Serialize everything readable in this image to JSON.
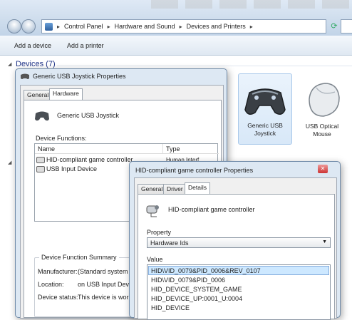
{
  "explorer": {
    "breadcrumbs": [
      "Control Panel",
      "Hardware and Sound",
      "Devices and Printers"
    ],
    "commands": [
      "Add a device",
      "Add a printer"
    ],
    "devices_heading": "Devices (7)",
    "tiles": [
      {
        "label_line1": "Generic   USB",
        "label_line2": "Joystick"
      },
      {
        "label_line1": "USB Optical",
        "label_line2": "Mouse"
      }
    ]
  },
  "props": {
    "title": "Generic   USB  Joystick Properties",
    "tabs": [
      "General",
      "Hardware"
    ],
    "device_name": "Generic   USB  Joystick",
    "functions_label": "Device Functions:",
    "columns": [
      "Name",
      "Type"
    ],
    "rows": [
      {
        "name": "HID-compliant game controller",
        "type": "Human Interf..."
      },
      {
        "name": "USB Input Device",
        "type": "..."
      }
    ],
    "summary_label": "Device Function Summary",
    "summary": [
      {
        "label": "Manufacturer:",
        "value": "(Standard system devic"
      },
      {
        "label": "Location:",
        "value": "on USB Input Device"
      },
      {
        "label": "Device status:",
        "value": "This device is working"
      }
    ]
  },
  "hid": {
    "title": "HID-compliant game controller Properties",
    "tabs": [
      "General",
      "Driver",
      "Details"
    ],
    "device_name": "HID-compliant game controller",
    "property_label": "Property",
    "property_value": "Hardware Ids",
    "value_label": "Value",
    "values": [
      "HID\\VID_0079&PID_0006&REV_0107",
      "HID\\VID_0079&PID_0006",
      "HID_DEVICE_SYSTEM_GAME",
      "HID_DEVICE_UP:0001_U:0004",
      "HID_DEVICE"
    ]
  },
  "colors": {
    "accent": "#1e3287",
    "selection": "#cde8ff"
  }
}
